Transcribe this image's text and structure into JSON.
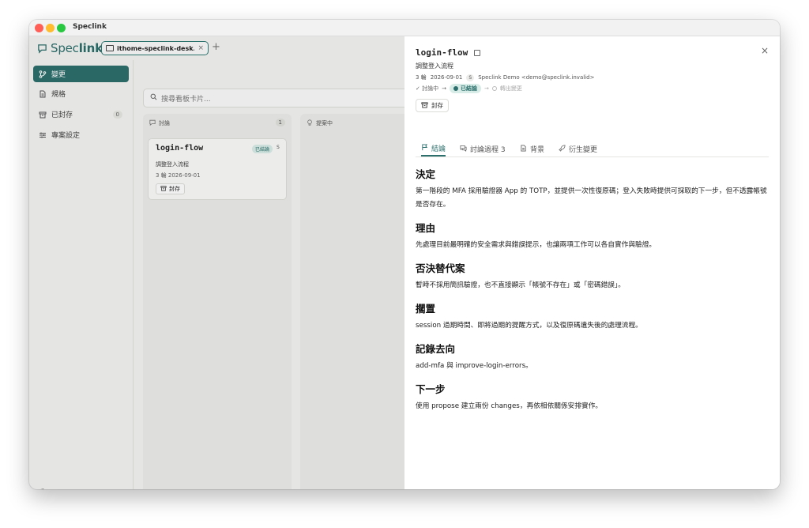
{
  "window": {
    "title": "Speclink"
  },
  "logo": {
    "text_a": "Spec",
    "text_b": "link"
  },
  "workspace_tab": {
    "label": "ithome-speclink-desk..."
  },
  "sidebar": {
    "items": [
      {
        "label": "變更"
      },
      {
        "label": "規格"
      },
      {
        "label": "已封存",
        "count": "0"
      },
      {
        "label": "專案設定"
      }
    ],
    "settings_label": "設定"
  },
  "search": {
    "placeholder": "搜尋看板卡片..."
  },
  "board": {
    "columns": [
      {
        "title": "討論",
        "count": "1"
      },
      {
        "title": "提案中"
      }
    ],
    "card": {
      "title": "login-flow",
      "badge": "已結論",
      "s_badge": "S",
      "description": "調整登入流程",
      "meta": "3 輪  2026-09-01",
      "archive_label": "封存"
    }
  },
  "panel": {
    "title": "login-flow",
    "description": "調整登入流程",
    "meta_rounds": "3 輪",
    "meta_date": "2026-09-01",
    "meta_s": "S",
    "meta_author": "Speclink Demo <demo@speclink.invalid>",
    "flow": {
      "step1": "✓ 討論中",
      "step2": "已結論",
      "step3": "轉出變更"
    },
    "archive_label": "封存",
    "tabs": [
      {
        "label": "結論"
      },
      {
        "label": "討論過程 3"
      },
      {
        "label": "背景"
      },
      {
        "label": "衍生變更"
      }
    ],
    "sections": [
      {
        "heading": "決定",
        "body": "第一階段的 MFA 採用驗證器 App 的 TOTP，並提供一次性復原碼；登入失敗時提供可採取的下一步，但不透露帳號是否存在。"
      },
      {
        "heading": "理由",
        "body": "先處理目前最明確的安全需求與錯誤提示，也讓兩項工作可以各自實作與驗證。"
      },
      {
        "heading": "否決替代案",
        "body": "暫時不採用簡訊驗證，也不直接顯示「帳號不存在」或「密碼錯誤」。"
      },
      {
        "heading": "擱置",
        "body": "session 過期時間、即將過期的提醒方式，以及復原碼遺失後的處理流程。"
      },
      {
        "heading": "記錄去向",
        "body": "add-mfa 與 improve-login-errors。"
      },
      {
        "heading": "下一步",
        "body": "使用 propose 建立兩份 changes，再依相依關係安排實作。"
      }
    ]
  },
  "colors": {
    "accent": "#2c6f6c",
    "badge_bg": "#d8ece7"
  }
}
